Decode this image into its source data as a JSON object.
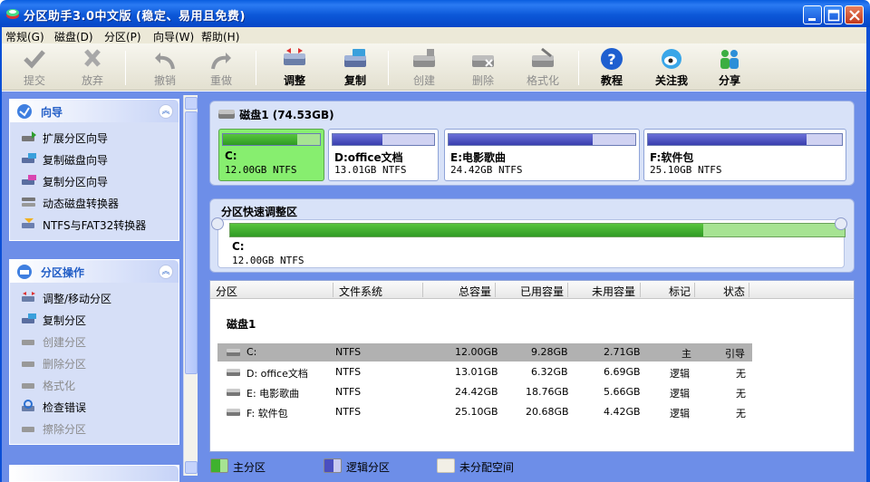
{
  "window": {
    "title": "分区助手3.0中文版 (稳定、易用且免费)"
  },
  "menu": [
    "常规(G)",
    "磁盘(D)",
    "分区(P)",
    "向导(W)",
    "帮助(H)"
  ],
  "toolbar": {
    "submit": "提交",
    "discard": "放弃",
    "undo": "撤销",
    "redo": "重做",
    "resize": "调整",
    "copy": "复制",
    "create": "创建",
    "delete": "删除",
    "format": "格式化",
    "tutorial": "教程",
    "follow": "关注我",
    "share": "分享"
  },
  "sidebar": {
    "wizard": {
      "title": "向导",
      "items": [
        "扩展分区向导",
        "复制磁盘向导",
        "复制分区向导",
        "动态磁盘转换器",
        "NTFS与FAT32转换器"
      ]
    },
    "ops": {
      "title": "分区操作",
      "items": [
        "调整/移动分区",
        "复制分区",
        "创建分区",
        "删除分区",
        "格式化",
        "检查错误",
        "擦除分区"
      ]
    }
  },
  "disk": {
    "header": "磁盘1 (74.53GB)",
    "partitions": [
      {
        "name": "C:",
        "info": "12.00GB NTFS",
        "used_fraction": 0.77
      },
      {
        "name": "D:office文档",
        "info": "13.01GB NTFS",
        "used_fraction": 0.49
      },
      {
        "name": "E:电影歌曲",
        "info": "24.42GB NTFS",
        "used_fraction": 0.77
      },
      {
        "name": "F:软件包",
        "info": "25.10GB NTFS",
        "used_fraction": 0.82
      }
    ]
  },
  "quick": {
    "title": "分区快速调整区",
    "drive": "C:",
    "info": "12.00GB NTFS",
    "used_fraction": 0.77
  },
  "table": {
    "headers": [
      "分区",
      "文件系统",
      "总容量",
      "已用容量",
      "未用容量",
      "标记",
      "状态"
    ],
    "disk_label": "磁盘1",
    "rows": [
      {
        "part": "C:",
        "fs": "NTFS",
        "total": "12.00GB",
        "used": "9.28GB",
        "free": "2.71GB",
        "flag": "主",
        "status": "引导"
      },
      {
        "part": "D: office文档",
        "fs": "NTFS",
        "total": "13.01GB",
        "used": "6.32GB",
        "free": "6.69GB",
        "flag": "逻辑",
        "status": "无"
      },
      {
        "part": "E: 电影歌曲",
        "fs": "NTFS",
        "total": "24.42GB",
        "used": "18.76GB",
        "free": "5.66GB",
        "flag": "逻辑",
        "status": "无"
      },
      {
        "part": "F: 软件包",
        "fs": "NTFS",
        "total": "25.10GB",
        "used": "20.68GB",
        "free": "4.42GB",
        "flag": "逻辑",
        "status": "无"
      }
    ]
  },
  "legend": {
    "primary": "主分区",
    "logical": "逻辑分区",
    "unallocated": "未分配空间"
  },
  "colors": {
    "primary": "#3fb22e",
    "logical": "#4a4fc0",
    "unallocated": "#f2efe6",
    "selected_partition": "#87ee6f"
  }
}
